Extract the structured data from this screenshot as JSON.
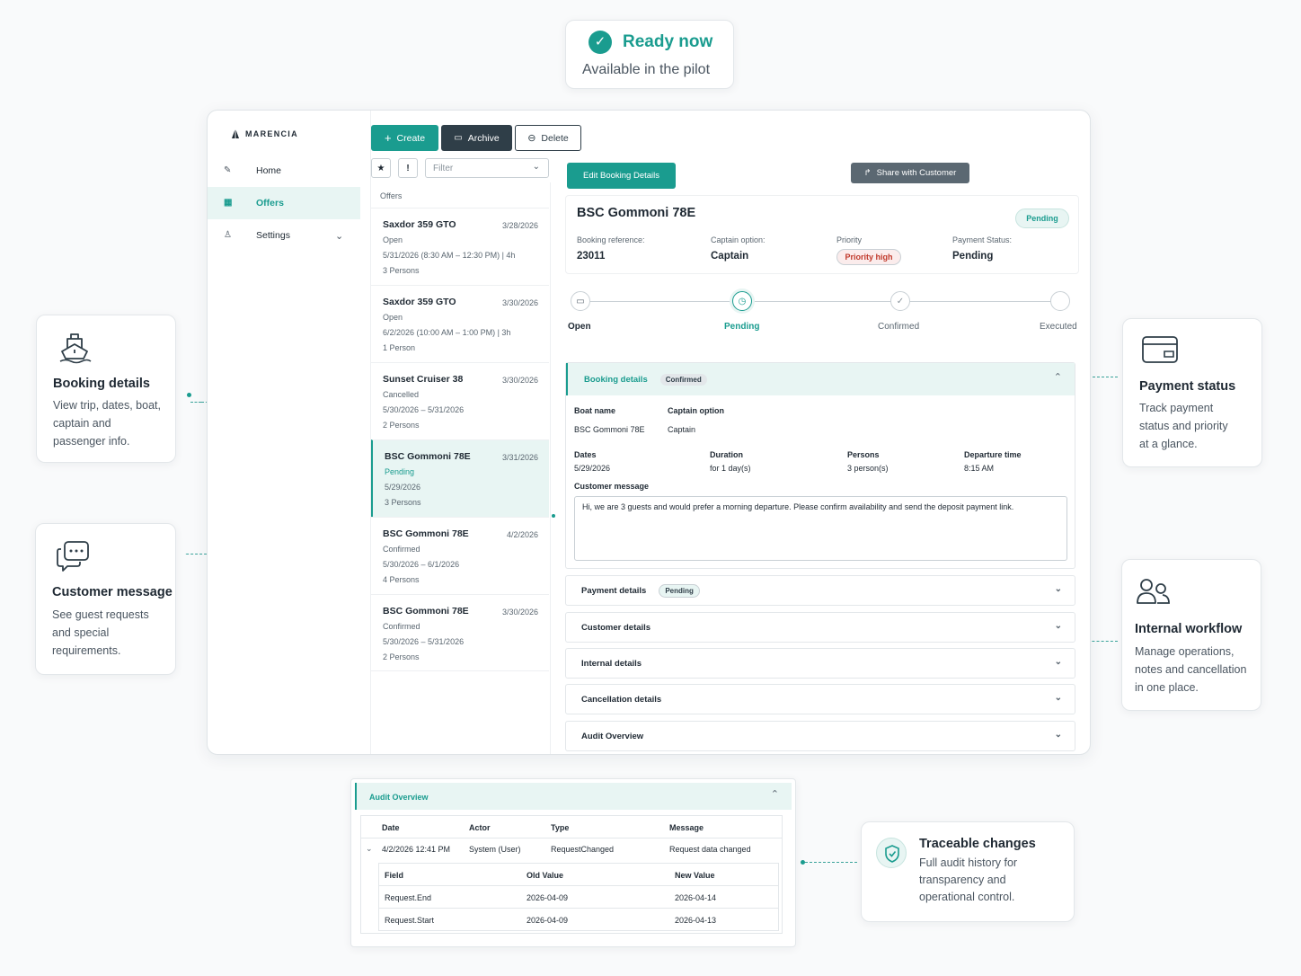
{
  "badge": {
    "title": "Ready now",
    "subtitle": "Available in the pilot"
  },
  "features": {
    "booking": {
      "title": "Booking details",
      "desc": [
        "View trip, dates, boat,",
        "captain and",
        "passenger info."
      ]
    },
    "message": {
      "title": "Customer message",
      "desc": [
        "See guest requests",
        "and special",
        "requirements."
      ]
    },
    "payment": {
      "title": "Payment status",
      "desc": [
        "Track payment",
        "status and priority",
        "at a glance."
      ]
    },
    "workflow": {
      "title": "Internal workflow",
      "desc": [
        "Manage operations,",
        "notes and cancellation",
        "in one place."
      ]
    },
    "trace": {
      "title": "Traceable changes",
      "desc": [
        "Full audit history for",
        "transparency and",
        "operational control."
      ]
    }
  },
  "app": {
    "brand": "MARENCIA",
    "nav": [
      {
        "label": "Home",
        "icon": "edit-icon"
      },
      {
        "label": "Offers",
        "icon": "grid-icon"
      },
      {
        "label": "Settings",
        "icon": "user-icon"
      }
    ],
    "toolbar": {
      "create": "Create",
      "archive": "Archive",
      "delete": "Delete",
      "filter_placeholder": "Filter"
    },
    "list_header": "Offers",
    "offers": [
      {
        "title": "Saxdor 359 GTO",
        "date": "3/28/2026",
        "status": "Open",
        "range": "5/31/2026 (8:30 AM – 12:30 PM) | 4h",
        "persons": "3 Persons"
      },
      {
        "title": "Saxdor 359 GTO",
        "date": "3/30/2026",
        "status": "Open",
        "range": "6/2/2026 (10:00 AM – 1:00 PM) | 3h",
        "persons": "1 Person"
      },
      {
        "title": "Sunset Cruiser 38",
        "date": "3/30/2026",
        "status": "Cancelled",
        "range": "5/30/2026 – 5/31/2026",
        "persons": "2 Persons"
      },
      {
        "title": "BSC Gommoni 78E",
        "date": "3/31/2026",
        "status": "Pending",
        "range": "5/29/2026",
        "persons": "3 Persons"
      },
      {
        "title": "BSC Gommoni 78E",
        "date": "4/2/2026",
        "status": "Confirmed",
        "range": "5/30/2026 – 6/1/2026",
        "persons": "4 Persons"
      },
      {
        "title": "BSC Gommoni 78E",
        "date": "3/30/2026",
        "status": "Confirmed",
        "range": "5/30/2026 – 5/31/2026",
        "persons": "2 Persons"
      }
    ],
    "detail": {
      "edit_button": "Edit Booking Details",
      "share_button": "Share with Customer",
      "title": "BSC Gommoni 78E",
      "status": "Pending",
      "ref_label": "Booking reference:",
      "ref_value": "23011",
      "captain_label": "Captain option:",
      "captain_value": "Captain",
      "priority_label": "Priority",
      "priority_value": "Priority high",
      "payment_label": "Payment Status:",
      "payment_value": "Pending",
      "steps": [
        "Open",
        "Pending",
        "Confirmed",
        "Executed"
      ],
      "booking_section": {
        "title": "Booking details",
        "tag": "Confirmed",
        "boat_label": "Boat name",
        "boat_value": "BSC Gommoni 78E",
        "captain_label": "Captain option",
        "captain_value": "Captain",
        "dates_label": "Dates",
        "dates_value": "5/29/2026",
        "duration_label": "Duration",
        "duration_value": "for 1 day(s)",
        "persons_label": "Persons",
        "persons_value": "3 person(s)",
        "departure_label": "Departure time",
        "departure_value": "8:15 AM",
        "message_label": "Customer message",
        "message_value": "Hi, we are 3 guests and would prefer a morning departure. Please confirm availability and send the deposit payment link."
      },
      "sections": [
        {
          "title": "Payment details",
          "tag": "Pending"
        },
        {
          "title": "Customer details",
          "tag": ""
        },
        {
          "title": "Internal details",
          "tag": ""
        },
        {
          "title": "Cancellation details",
          "tag": ""
        },
        {
          "title": "Audit Overview",
          "tag": ""
        }
      ]
    }
  },
  "audit": {
    "title": "Audit Overview",
    "headers": [
      "Date",
      "Actor",
      "Type",
      "Message"
    ],
    "row": [
      "4/2/2026 12:41 PM",
      "System (User)",
      "RequestChanged",
      "Request data changed"
    ],
    "sub_headers": [
      "Field",
      "Old Value",
      "New Value"
    ],
    "sub_rows": [
      [
        "Request.End",
        "2026-04-09",
        "2026-04-14"
      ],
      [
        "Request.Start",
        "2026-04-09",
        "2026-04-13"
      ]
    ]
  }
}
